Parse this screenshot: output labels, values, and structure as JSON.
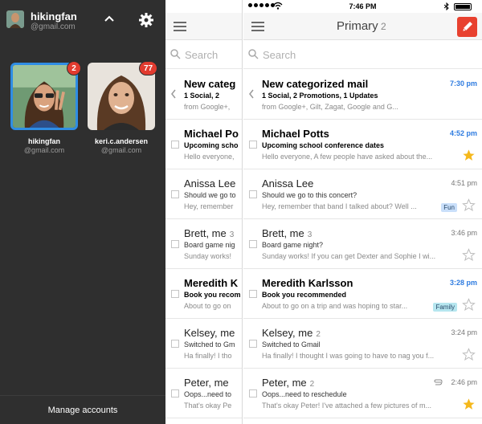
{
  "drawer": {
    "header": {
      "name": "hikingfan",
      "email": "@gmail.com"
    },
    "accounts": [
      {
        "name": "hikingfan",
        "email": "@gmail.com",
        "badge": "2"
      },
      {
        "name": "keri.c.andersen",
        "email": "@gmail.com",
        "badge": "77"
      }
    ],
    "manage_label": "Manage accounts"
  },
  "status": {
    "time": "7:46 PM"
  },
  "main": {
    "title": "Primary",
    "count": "2",
    "search_placeholder": "Search",
    "rows": [
      {
        "sender": "New categorized mail",
        "thread": "",
        "subject": "1 Social, 2 Promotions, 1 Updates",
        "snippet": "from Google+, Gilt, Zagat, Google and G...",
        "time": "7:30 pm"
      },
      {
        "sender": "Michael Potts",
        "thread": "",
        "subject": "Upcoming school conference dates",
        "snippet": "Hello everyone, A few people have asked about the...",
        "time": "4:52 pm"
      },
      {
        "sender": "Anissa Lee",
        "thread": "",
        "subject": "Should we go to this concert?",
        "snippet": "Hey, remember that band I talked about? Well ...",
        "time": "4:51 pm",
        "label": "Fun"
      },
      {
        "sender": "Brett, me",
        "thread": "3",
        "subject": "Board game night?",
        "snippet": "Sunday works! If you can get Dexter and Sophie I wi...",
        "time": "3:46 pm"
      },
      {
        "sender": "Meredith Karlsson",
        "thread": "",
        "subject": "Book you recommended",
        "snippet": "About to go on a trip and was hoping to star...",
        "time": "3:28 pm",
        "label": "Family"
      },
      {
        "sender": "Kelsey, me",
        "thread": "2",
        "subject": "Switched to Gmail",
        "snippet": "Ha finally! I thought I was going to have to nag you f...",
        "time": "3:24 pm"
      },
      {
        "sender": "Peter, me",
        "thread": "2",
        "subject": "Oops...need to reschedule",
        "snippet": "That's okay Peter! I've attached a few pictures of m...",
        "time": "2:46 pm"
      }
    ]
  },
  "mid": {
    "search_placeholder": "Search",
    "rows": [
      {
        "sender": "New categ",
        "thread": "",
        "subject": "1 Social, 2",
        "snippet": "from Google+,"
      },
      {
        "sender": "Michael Po",
        "thread": "",
        "subject": "Upcoming scho",
        "snippet": "Hello everyone,"
      },
      {
        "sender": "Anissa Lee",
        "thread": "",
        "subject": "Should we go to",
        "snippet": "Hey, remember"
      },
      {
        "sender": "Brett, me",
        "thread": "3",
        "subject": "Board game nig",
        "snippet": "Sunday works!"
      },
      {
        "sender": "Meredith K",
        "thread": "",
        "subject": "Book you recom",
        "snippet": "About to go on"
      },
      {
        "sender": "Kelsey, me",
        "thread": "",
        "subject": "Switched to Gm",
        "snippet": "Ha finally! I tho"
      },
      {
        "sender": "Peter, me",
        "thread": "",
        "subject": "Oops...need to",
        "snippet": "That's okay Pe"
      }
    ]
  },
  "colors": {
    "accent": "#2f8de4",
    "badge": "#e23b2f",
    "compose": "#e8412f",
    "star": "#f5b81c",
    "unread_time": "#2d7be0"
  }
}
